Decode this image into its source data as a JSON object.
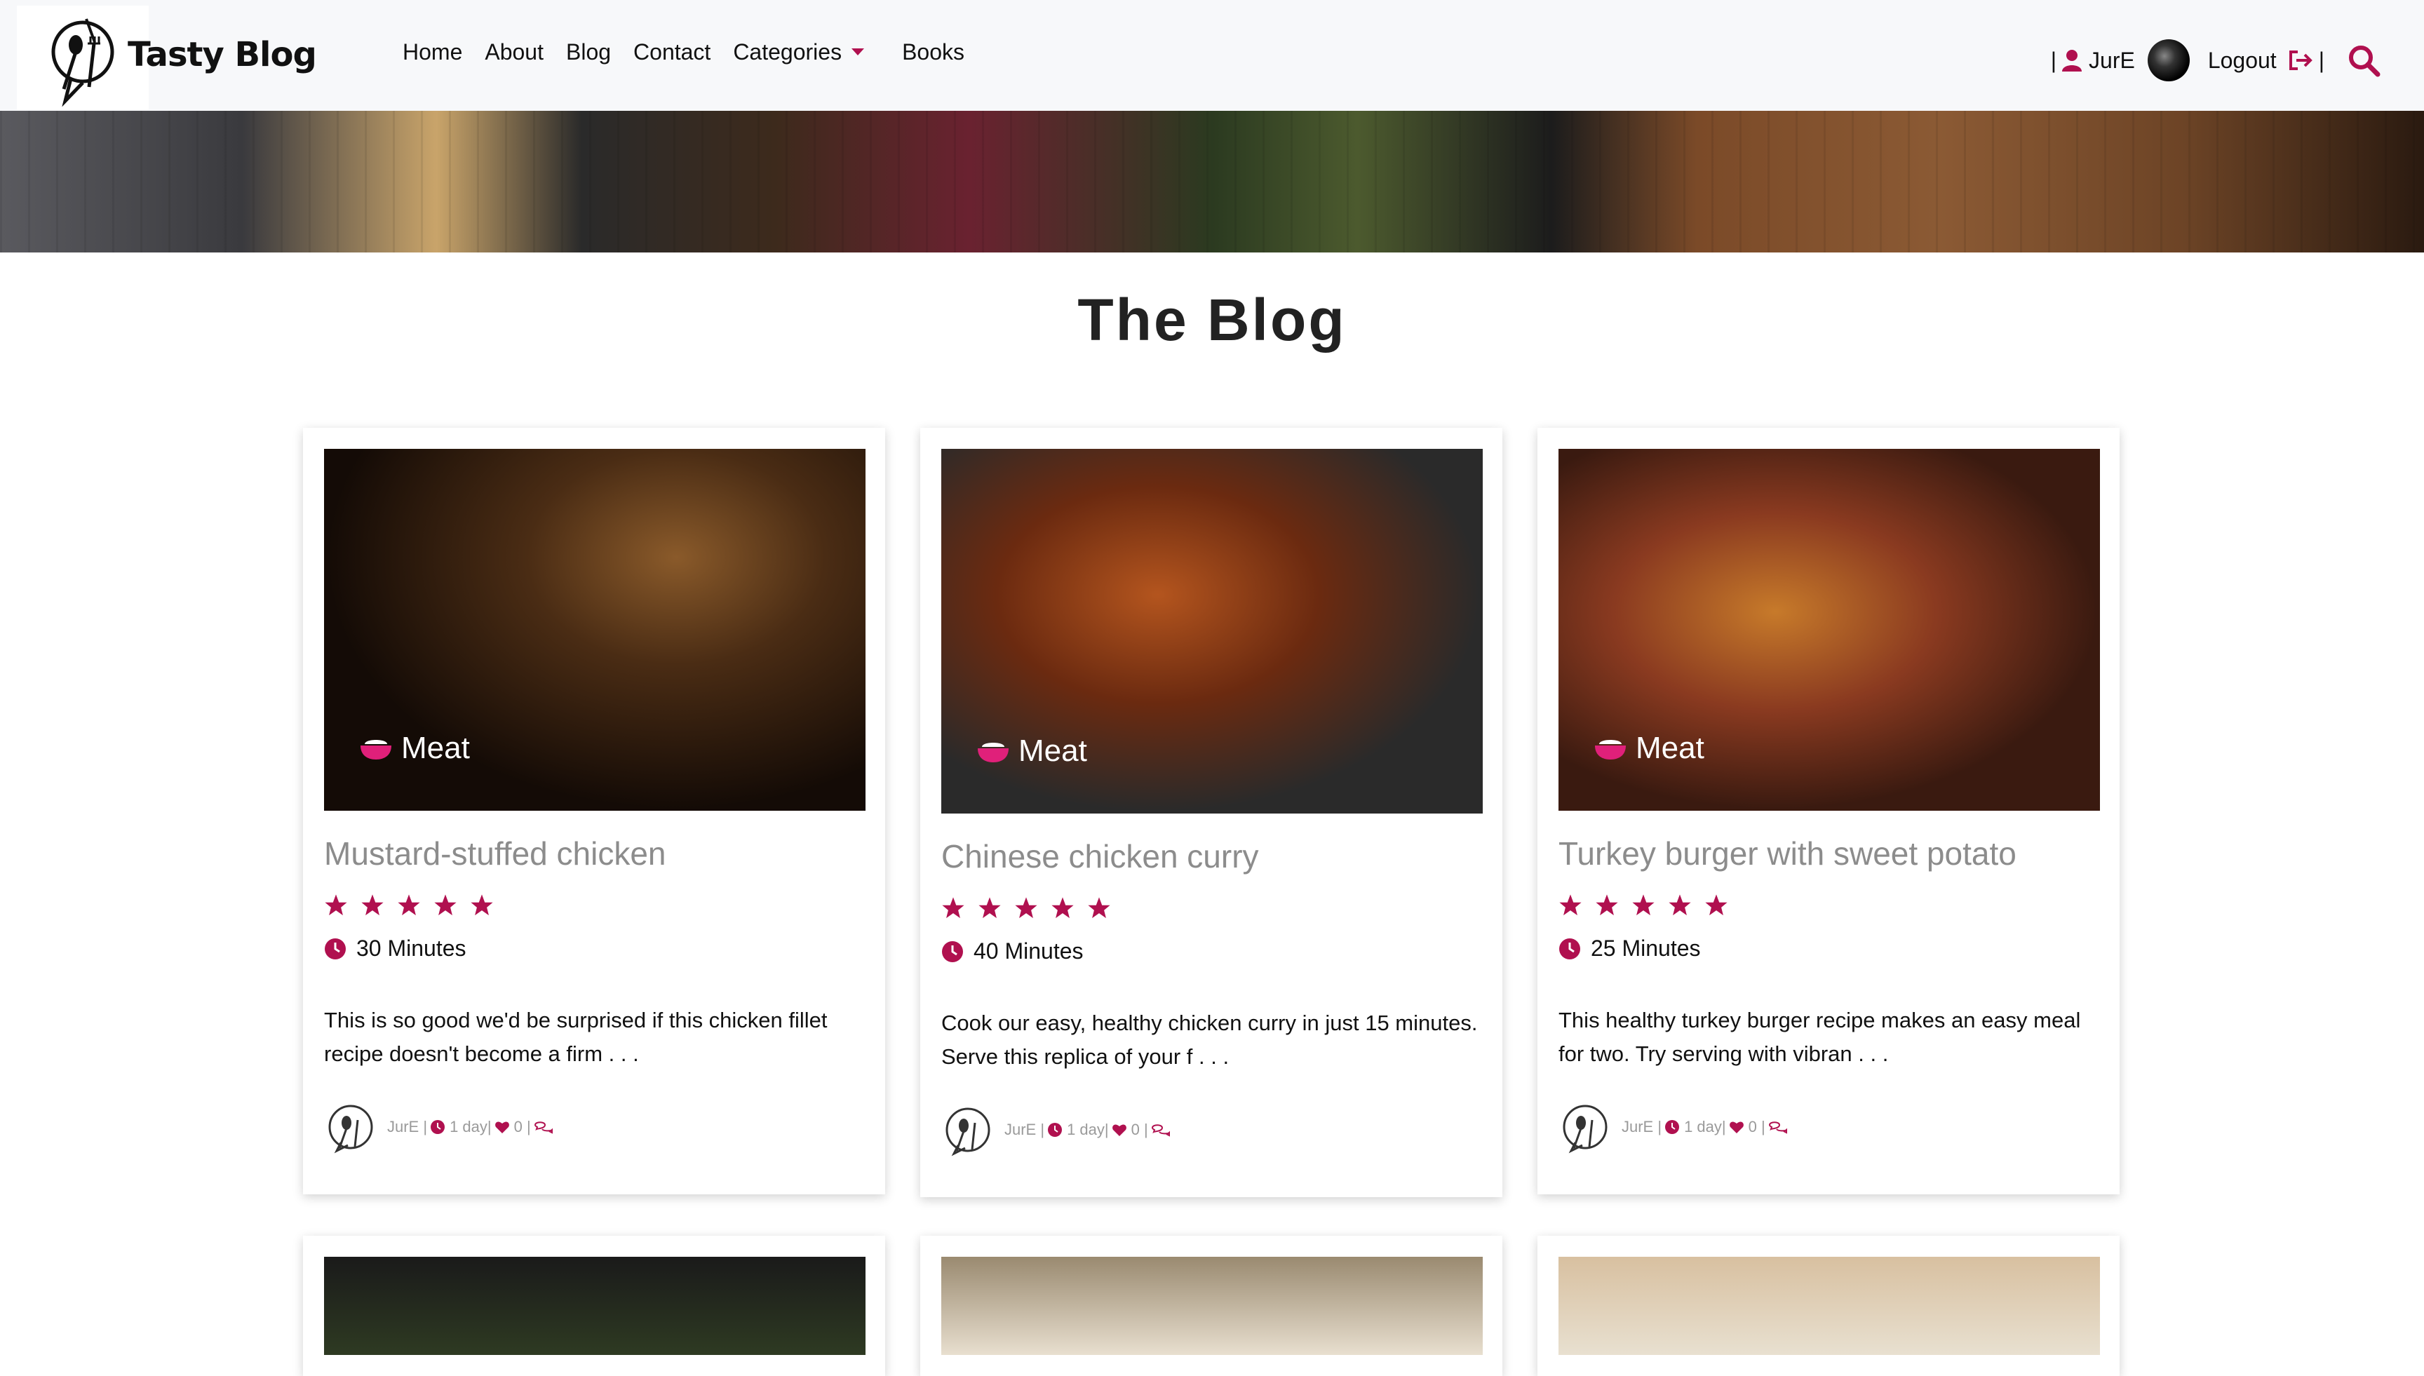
{
  "brand": {
    "name": "Tasty Blog"
  },
  "nav": {
    "links": [
      "Home",
      "About",
      "Blog",
      "Contact",
      "Categories",
      "Books"
    ]
  },
  "user": {
    "pipe_left": "|",
    "username": "JurE",
    "logout": "Logout",
    "pipe_right": "|"
  },
  "page": {
    "title": "The Blog"
  },
  "cards": [
    {
      "category": "Meat",
      "title": "Mustard-stuffed chicken",
      "rating": 5,
      "time": "30 Minutes",
      "excerpt": "This is so good we'd be surprised if this chicken fillet recipe doesn't become a firm . . .",
      "author": "JurE",
      "posted": "1 day",
      "likes": "0"
    },
    {
      "category": "Meat",
      "title": "Chinese chicken curry",
      "rating": 5,
      "time": "40 Minutes",
      "excerpt": "Cook our easy, healthy chicken curry in just 15 minutes. Serve this replica of your f . . .",
      "author": "JurE",
      "posted": "1 day",
      "likes": "0"
    },
    {
      "category": "Meat",
      "title": "Turkey burger with sweet potato",
      "rating": 5,
      "time": "25 Minutes",
      "excerpt": "This healthy turkey burger recipe makes an easy meal for two. Try serving with vibran . . .",
      "author": "JurE",
      "posted": "1 day",
      "likes": "0"
    }
  ],
  "colors": {
    "accent": "#b0104f",
    "nav_bg": "#f7f8fa",
    "title_gray": "#8c8c8c"
  }
}
